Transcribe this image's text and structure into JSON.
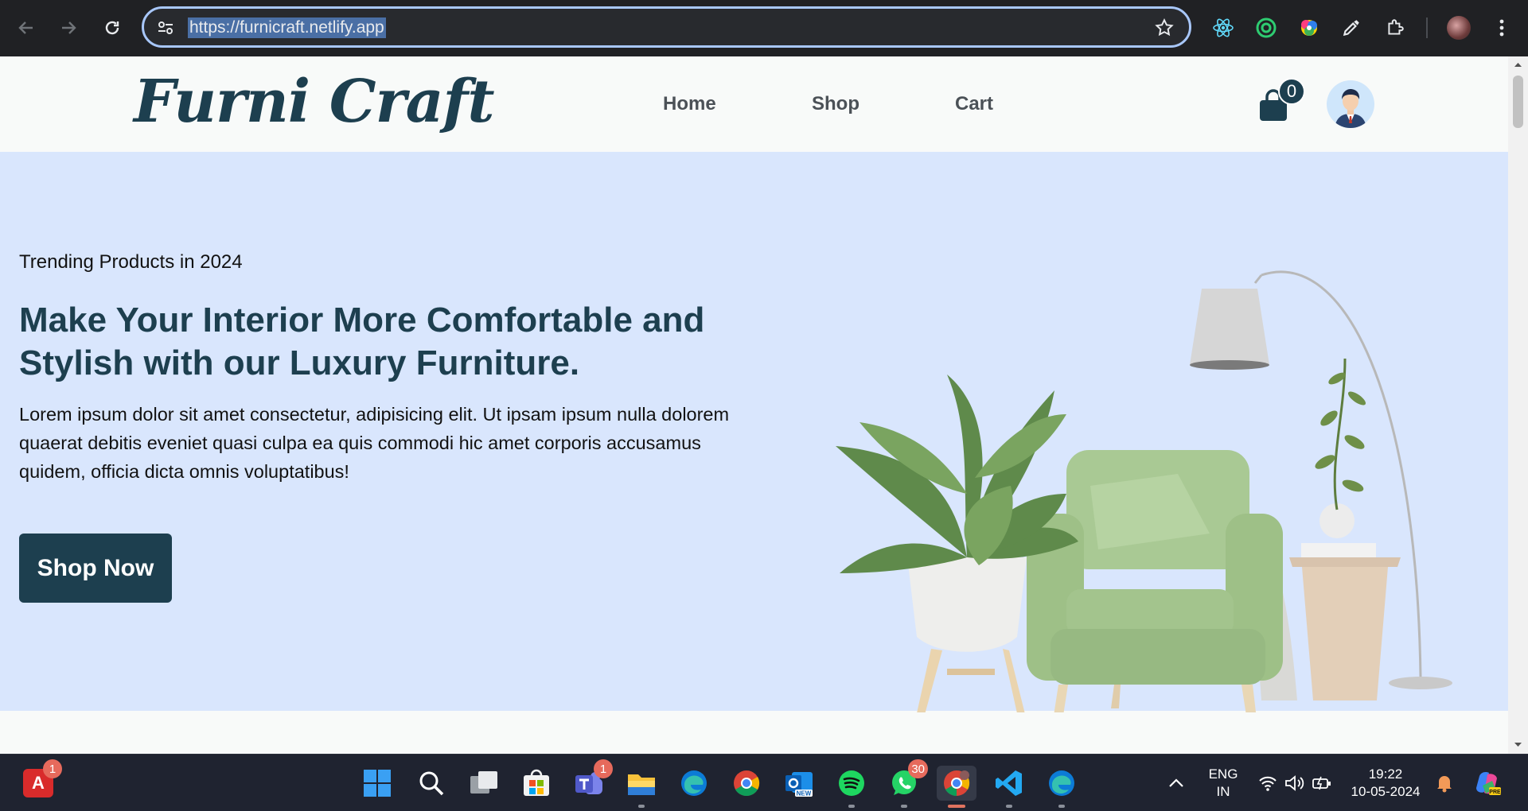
{
  "browser": {
    "url": "https://furnicraft.netlify.app",
    "icons": [
      "back-icon",
      "forward-icon",
      "reload-icon",
      "site-settings-icon",
      "bookmark-star-icon",
      "react-devtools-icon",
      "extension-ring-icon",
      "color-picker-icon",
      "eyedropper-icon",
      "extensions-puzzle-icon",
      "profile-avatar-icon",
      "kebab-menu-icon"
    ]
  },
  "site": {
    "logo": "Furni Craft",
    "nav": {
      "home": "Home",
      "shop": "Shop",
      "cart": "Cart"
    },
    "cart_count": "0"
  },
  "hero": {
    "eyebrow": "Trending Products in 2024",
    "headline": "Make Your Interior More Comfortable and Stylish with our Luxury Furniture.",
    "body": "Lorem ipsum dolor sit amet consectetur, adipisicing elit. Ut ipsam ipsum nulla dolorem quaerat debitis eveniet quasi culpa ea quis commodi hic amet corporis accusamus quidem, officia dicta omnis voluptatibus!",
    "cta": "Shop Now"
  },
  "taskbar": {
    "acrobat_badge": "1",
    "teams_badge": "1",
    "whatsapp_badge": "30",
    "lang_line1": "ENG",
    "lang_line2": "IN",
    "time": "19:22",
    "date": "10-05-2024"
  },
  "colors": {
    "brand": "#1d3f4f",
    "hero_bg": "#d9e6fd",
    "chrome_bg": "#202124",
    "taskbar_bg": "#1f2330"
  }
}
